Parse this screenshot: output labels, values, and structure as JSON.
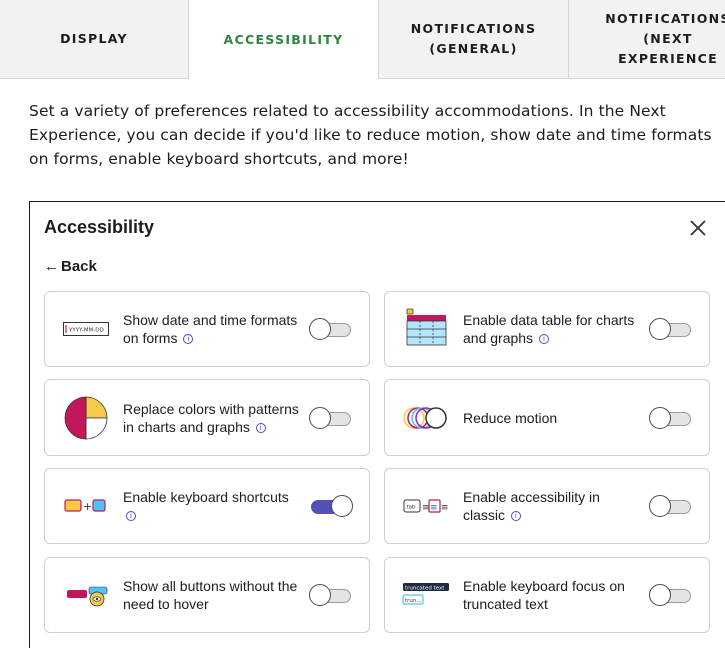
{
  "tabs": [
    {
      "label": "DISPLAY",
      "active": false
    },
    {
      "label": "ACCESSIBILITY",
      "active": true
    },
    {
      "label": "NOTIFICATIONS\n(GENERAL)",
      "active": false
    },
    {
      "label": "NOTIFICATIONS\n(NEXT EXPERIENCE",
      "active": false
    }
  ],
  "description": "Set a variety of preferences related to accessibility accommodations. In the Next Experience, you can decide if you'd like to reduce motion, show date and time formats on forms, enable keyboard shortcuts, and more!",
  "panel": {
    "title": "Accessibility",
    "back_label": "Back",
    "close_icon": "close-icon",
    "date_icon_text": "YYYY-MM-DD",
    "truncated_icon_text": "truncated text",
    "truncated_short_text": "trun...",
    "tab_icon_text": "tab",
    "cards": [
      {
        "label": "Show date and time formats on forms",
        "info": true,
        "on": false,
        "icon": "date-format-icon"
      },
      {
        "label": "Enable data table for charts and graphs",
        "info": true,
        "on": false,
        "icon": "data-table-icon"
      },
      {
        "label": "Replace colors with patterns in charts and graphs",
        "info": true,
        "on": false,
        "icon": "pie-pattern-icon"
      },
      {
        "label": "Reduce motion",
        "info": false,
        "on": false,
        "icon": "reduce-motion-icon"
      },
      {
        "label": "Enable keyboard shortcuts",
        "info": true,
        "on": true,
        "icon": "keyboard-shortcut-icon"
      },
      {
        "label": "Enable accessibility in classic",
        "info": true,
        "on": false,
        "icon": "classic-accessibility-icon"
      },
      {
        "label": "Show all buttons without the need to hover",
        "info": false,
        "on": false,
        "icon": "hover-buttons-icon"
      },
      {
        "label": "Enable keyboard focus on truncated text",
        "info": false,
        "on": false,
        "icon": "truncated-text-icon"
      }
    ]
  },
  "colors": {
    "accent_green": "#2e8540",
    "toggle_on": "#5351b8",
    "info_blue": "#4a4ad0"
  }
}
